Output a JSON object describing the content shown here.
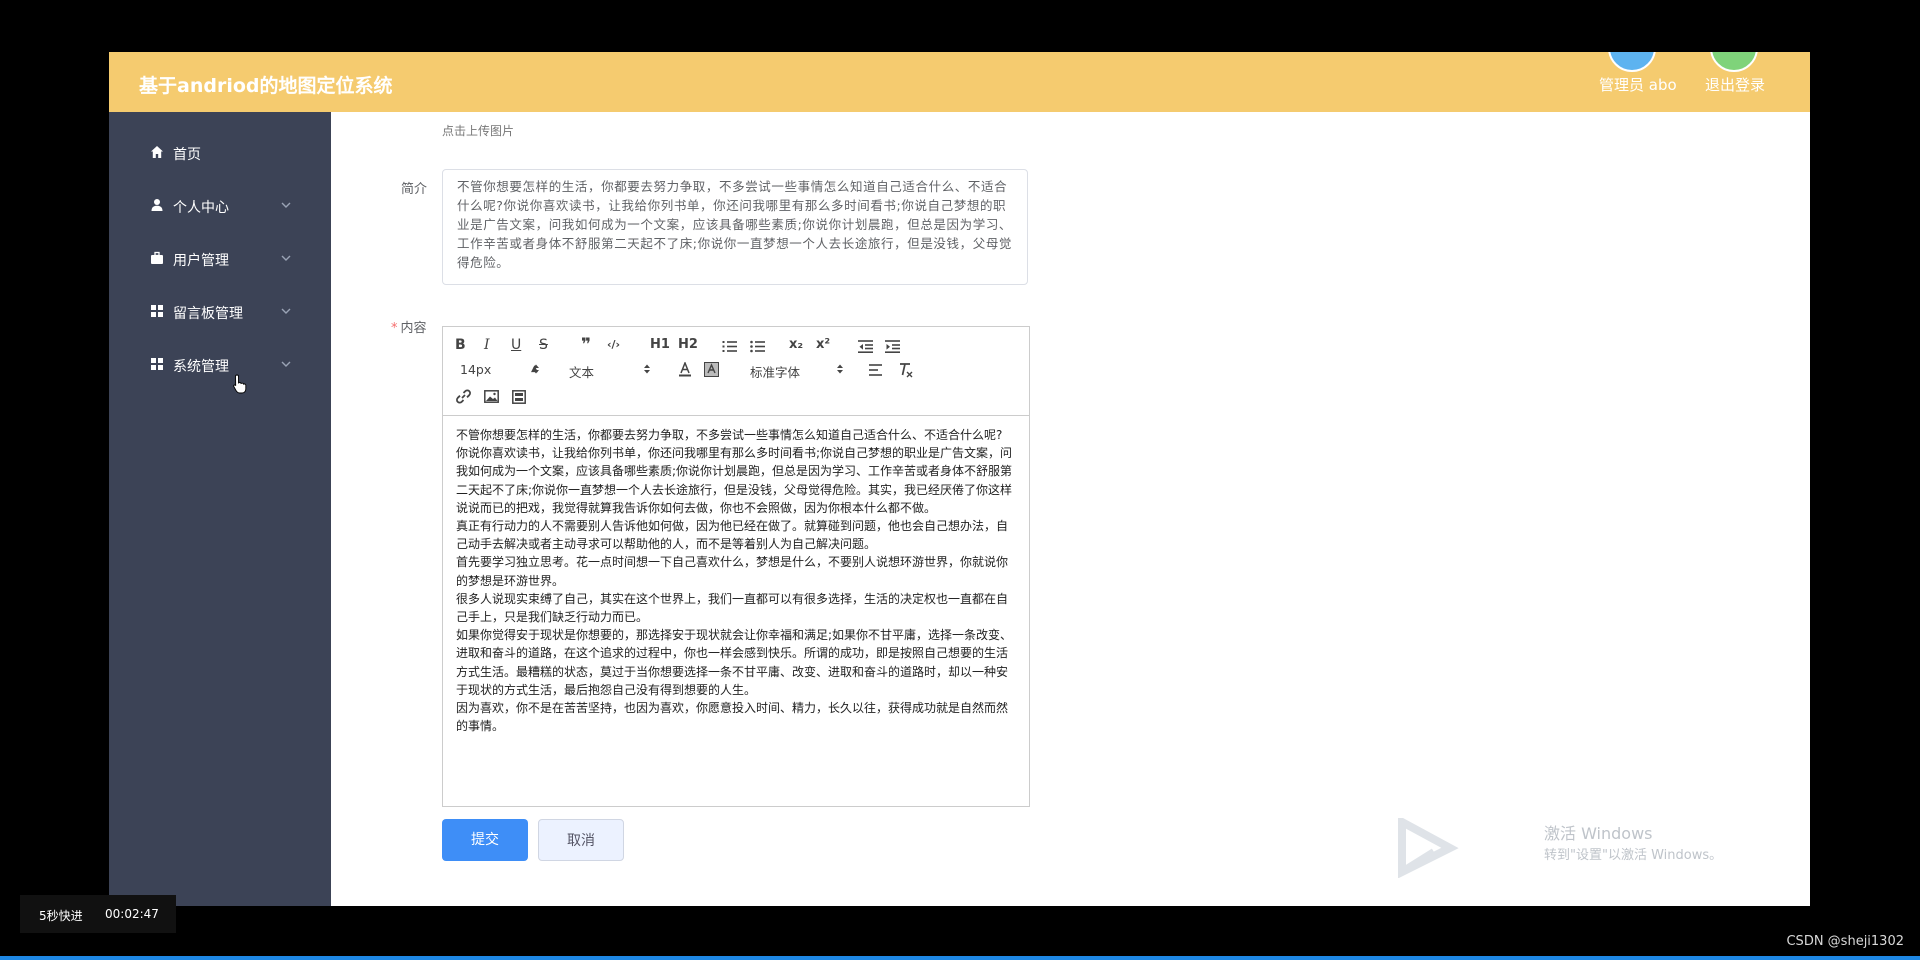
{
  "header": {
    "title": "基于andriod的地图定位系统",
    "admin_label": "管理员 abo",
    "logout_label": "退出登录"
  },
  "sidebar": {
    "items": [
      {
        "label": "首页",
        "icon": "home-icon"
      },
      {
        "label": "个人中心",
        "icon": "user-icon"
      },
      {
        "label": "用户管理",
        "icon": "briefcase-icon"
      },
      {
        "label": "留言板管理",
        "icon": "grid-icon"
      },
      {
        "label": "系统管理",
        "icon": "grid-icon"
      }
    ]
  },
  "form": {
    "upload_hint": "点击上传图片",
    "intro_label": "简介",
    "intro_value": "不管你想要怎样的生活，你都要去努力争取，不多尝试一些事情怎么知道自己适合什么、不适合什么呢?你说你喜欢读书，让我给你列书单，你还问我哪里有那么多时间看书;你说自己梦想的职业是广告文案，问我如何成为一个文案，应该具备哪些素质;你说你计划晨跑，但总是因为学习、工作辛苦或者身体不舒服第二天起不了床;你说你一直梦想一个人去长途旅行，但是没钱，父母觉得危险。",
    "content_required": "*",
    "content_label": "内容",
    "submit_label": "提交",
    "cancel_label": "取消"
  },
  "editor": {
    "toolbar": {
      "bold": "B",
      "italic": "I",
      "underline": "U",
      "strike": "S",
      "quote": "❞",
      "code": "‹/›",
      "h1": "H1",
      "h2": "H2",
      "subscript": "x₂",
      "superscript": "x²",
      "size_value": "14px",
      "header_value": "文本",
      "font_value": "标准字体"
    },
    "paragraphs": [
      "不管你想要怎样的生活，你都要去努力争取，不多尝试一些事情怎么知道自己适合什么、不适合什么呢?",
      "你说你喜欢读书，让我给你列书单，你还问我哪里有那么多时间看书;你说自己梦想的职业是广告文案，问我如何成为一个文案，应该具备哪些素质;你说你计划晨跑，但总是因为学习、工作辛苦或者身体不舒服第二天起不了床;你说你一直梦想一个人去长途旅行，但是没钱，父母觉得危险。其实，我已经厌倦了你这样说说而已的把戏，我觉得就算我告诉你如何去做，你也不会照做，因为你根本什么都不做。",
      "真正有行动力的人不需要别人告诉他如何做，因为他已经在做了。就算碰到问题，他也会自己想办法，自己动手去解决或者主动寻求可以帮助他的人，而不是等着别人为自己解决问题。",
      "首先要学习独立思考。花一点时间想一下自己喜欢什么，梦想是什么，不要别人说想环游世界，你就说你的梦想是环游世界。",
      "很多人说现实束缚了自己，其实在这个世界上，我们一直都可以有很多选择，生活的决定权也一直都在自己手上，只是我们缺乏行动力而已。",
      "如果你觉得安于现状是你想要的，那选择安于现状就会让你幸福和满足;如果你不甘平庸，选择一条改变、进取和奋斗的道路，在这个追求的过程中，你也一样会感到快乐。所谓的成功，即是按照自己想要的生活方式生活。最糟糕的状态，莫过于当你想要选择一条不甘平庸、改变、进取和奋斗的道路时，却以一种安于现状的方式生活，最后抱怨自己没有得到想要的人生。",
      "因为喜欢，你不是在苦苦坚持，也因为喜欢，你愿意投入时间、精力，长久以往，获得成功就是自然而然的事情。"
    ]
  },
  "watermark": {
    "line1": "激活 Windows",
    "line2": "转到\"设置\"以激活 Windows。"
  },
  "video_overlay": {
    "fast_forward": "5秒快进",
    "time": "00:02:47"
  },
  "csdn_credit": "CSDN @sheji1302"
}
